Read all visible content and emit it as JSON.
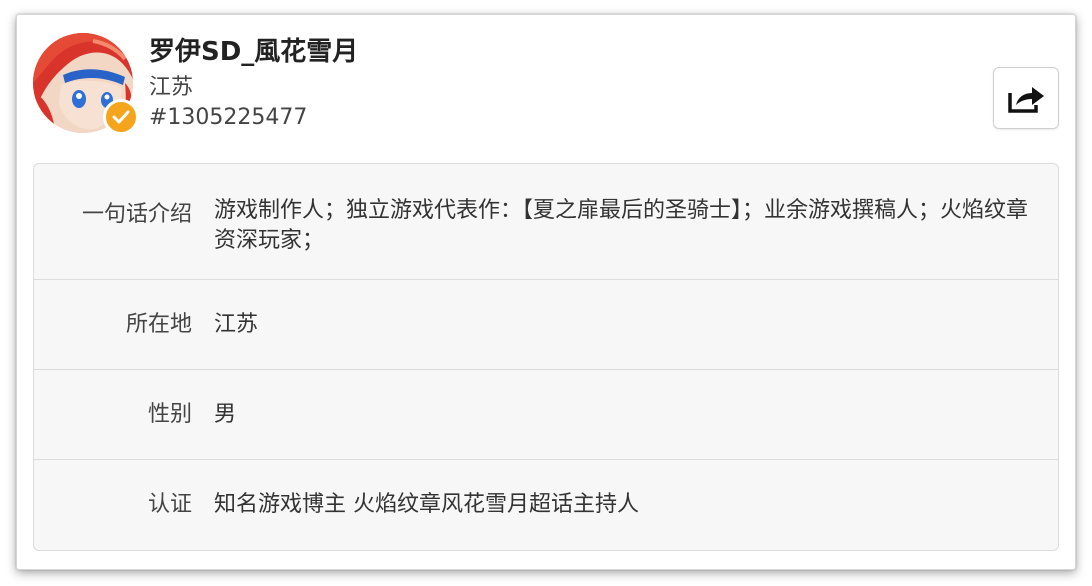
{
  "profile": {
    "name": "罗伊SD_風花雪月",
    "region": "江苏",
    "uid": "#1305225477",
    "verified_badge_color": "#f4a51c"
  },
  "actions": {
    "share_icon": "share-icon"
  },
  "info": {
    "bio_label": "一句话介绍",
    "bio_value": "游戏制作人；独立游戏代表作：【夏之扉最后的圣骑士】；业余游戏撰稿人；火焰纹章资深玩家；",
    "location_label": "所在地",
    "location_value": "江苏",
    "gender_label": "性别",
    "gender_value": "男",
    "cert_label": "认证",
    "cert_value": "知名游戏博主 火焰纹章风花雪月超话主持人"
  }
}
